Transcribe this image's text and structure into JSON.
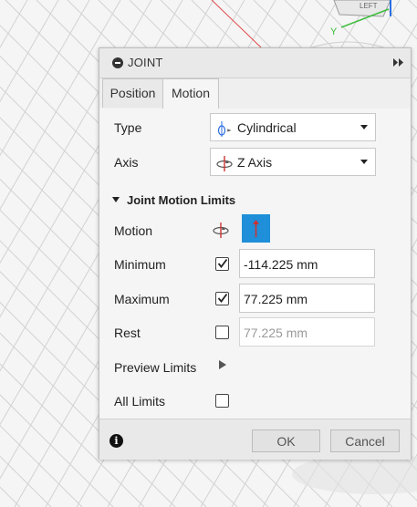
{
  "viewcube": {
    "face_label": "LEFT",
    "axis_label": "Y"
  },
  "dialog": {
    "title": "JOINT",
    "tabs": [
      {
        "label": "Position"
      },
      {
        "label": "Motion"
      }
    ],
    "type": {
      "label": "Type",
      "value": "Cylindrical",
      "icon": "cylindrical-joint-icon"
    },
    "axis": {
      "label": "Axis",
      "value": "Z Axis",
      "icon": "z-axis-icon"
    },
    "limits_section": {
      "label": "Joint Motion Limits",
      "expanded": true
    },
    "motion": {
      "label": "Motion",
      "rotation_icon": "rotation-axis-icon",
      "slide_icon": "slide-arrow-icon",
      "active_color": "#1e8fd8"
    },
    "minimum": {
      "label": "Minimum",
      "checked": true,
      "value": "-114.225 mm"
    },
    "maximum": {
      "label": "Maximum",
      "checked": true,
      "value": "77.225 mm"
    },
    "rest": {
      "label": "Rest",
      "checked": false,
      "value": "77.225 mm"
    },
    "preview_limits": {
      "label": "Preview Limits"
    },
    "all_limits": {
      "label": "All Limits",
      "checked": false
    },
    "footer": {
      "ok_label": "OK",
      "cancel_label": "Cancel",
      "info_icon": "info-icon"
    }
  }
}
